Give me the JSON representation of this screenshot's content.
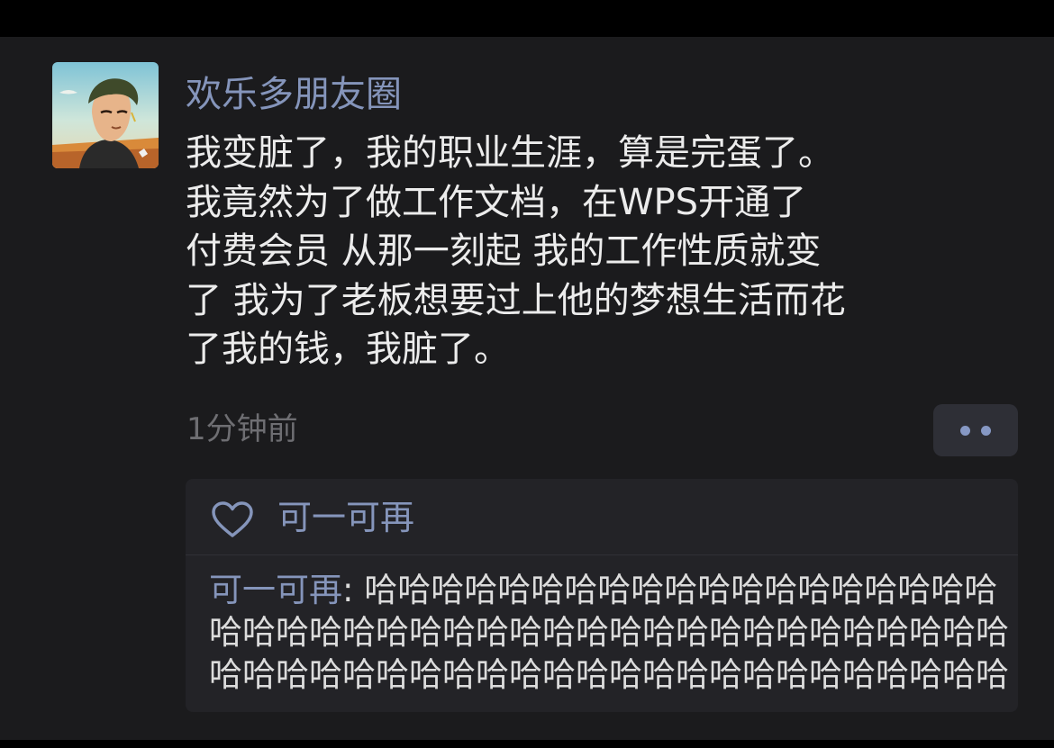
{
  "post": {
    "author": "欢乐多朋友圈",
    "content_lines": [
      "我变脏了，我的职业生涯，算是完蛋了。",
      "我竟然为了做工作文档，在WPS开通了",
      "付费会员 从那一刻起 我的工作性质就变",
      "了 我为了老板想要过上他的梦想生活而花",
      "了我的钱，我脏了。"
    ],
    "time": "1分钟前",
    "more_icon": "more-dots-icon"
  },
  "likes": {
    "icon": "heart-outline-icon",
    "names": "可一可再"
  },
  "comment": {
    "author": "可一可再",
    "separator": ": ",
    "text": "哈哈哈哈哈哈哈哈哈哈哈哈哈哈哈哈哈哈哈哈哈哈哈哈哈哈哈哈哈哈哈哈哈哈哈哈哈哈哈哈哈哈哈哈哈哈哈哈哈哈哈哈哈哈哈哈哈哈哈哈哈哈哈哈哈哈哈"
  },
  "colors": {
    "background": "#1b1b1d",
    "link_blue": "#8595bb",
    "text": "#ececec",
    "muted": "#6e6e72",
    "comment_panel": "#232327"
  }
}
